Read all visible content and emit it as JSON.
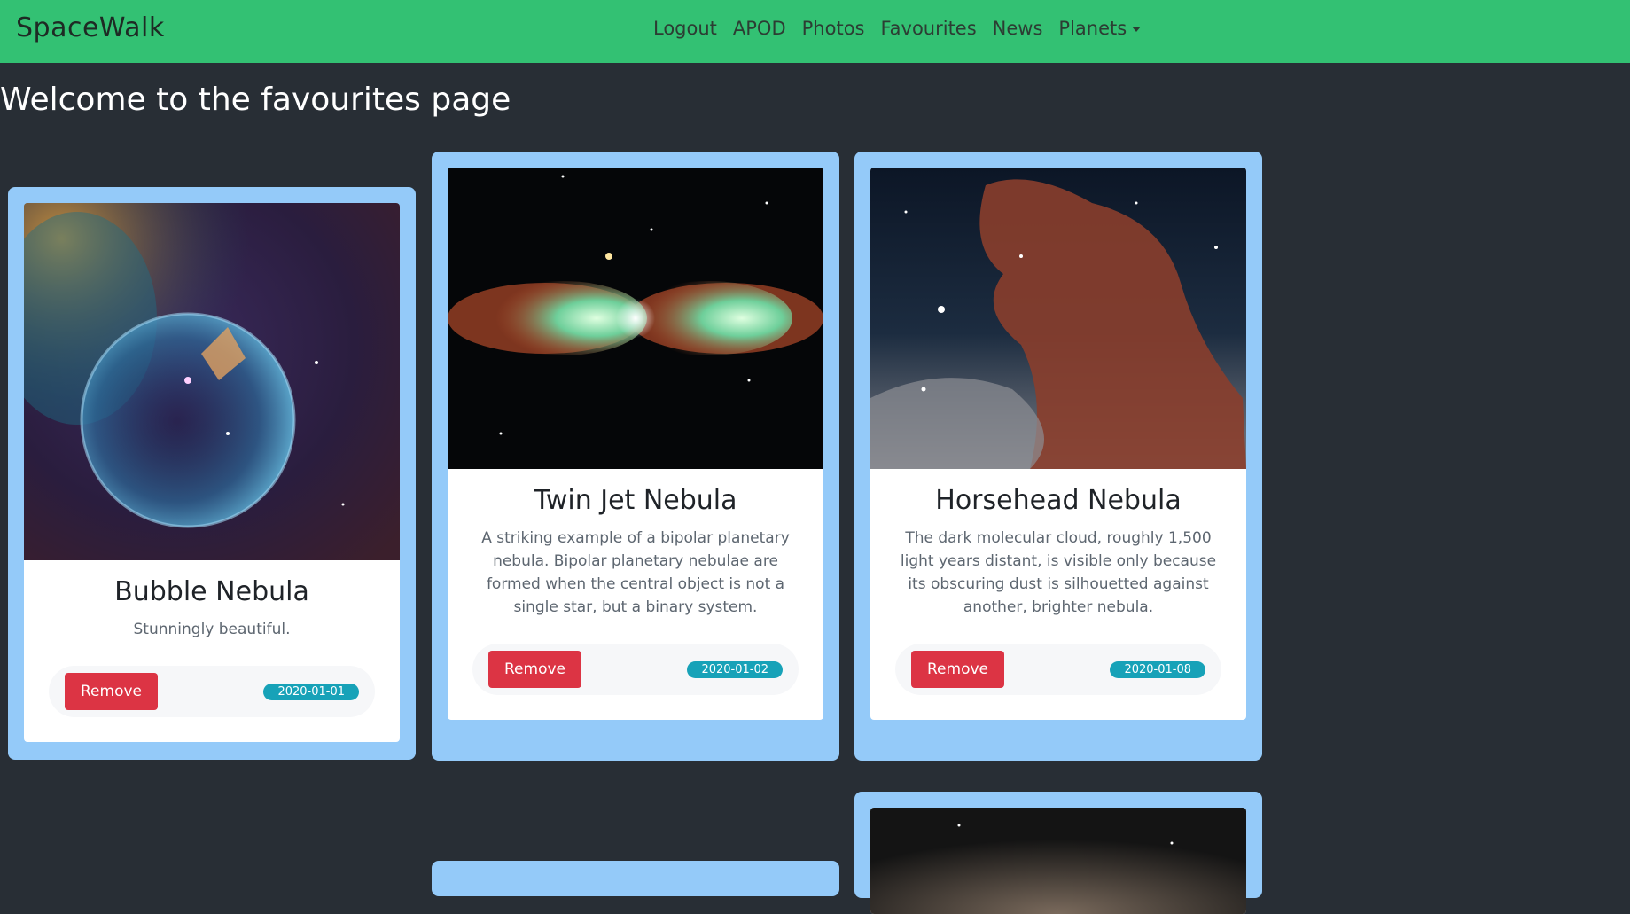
{
  "navbar": {
    "brand": "SpaceWalk",
    "links": [
      {
        "label": "Logout"
      },
      {
        "label": "APOD"
      },
      {
        "label": "Photos"
      },
      {
        "label": "Favourites"
      },
      {
        "label": "News"
      },
      {
        "label": "Planets"
      }
    ]
  },
  "page": {
    "title": "Welcome to the favourites page"
  },
  "cards": [
    {
      "title": "Bubble Nebula",
      "text": "Stunningly beautiful.",
      "button": "Remove",
      "date": "2020-01-01"
    },
    {
      "title": "Twin Jet Nebula",
      "text": "A striking example of a bipolar planetary nebula. Bipolar planetary nebulae are formed when the central object is not a single star, but a binary system.",
      "button": "Remove",
      "date": "2020-01-02"
    },
    {
      "title": "Horsehead Nebula",
      "text": "The dark molecular cloud, roughly 1,500 light years distant, is visible only because its obscuring dust is silhouetted against another, brighter nebula.",
      "button": "Remove",
      "date": "2020-01-08"
    }
  ],
  "colors": {
    "navbar": "#33c173",
    "background": "#282e35",
    "card_frame": "#94caf9",
    "remove_button": "#dc3444",
    "date_badge": "#17a2b8"
  }
}
